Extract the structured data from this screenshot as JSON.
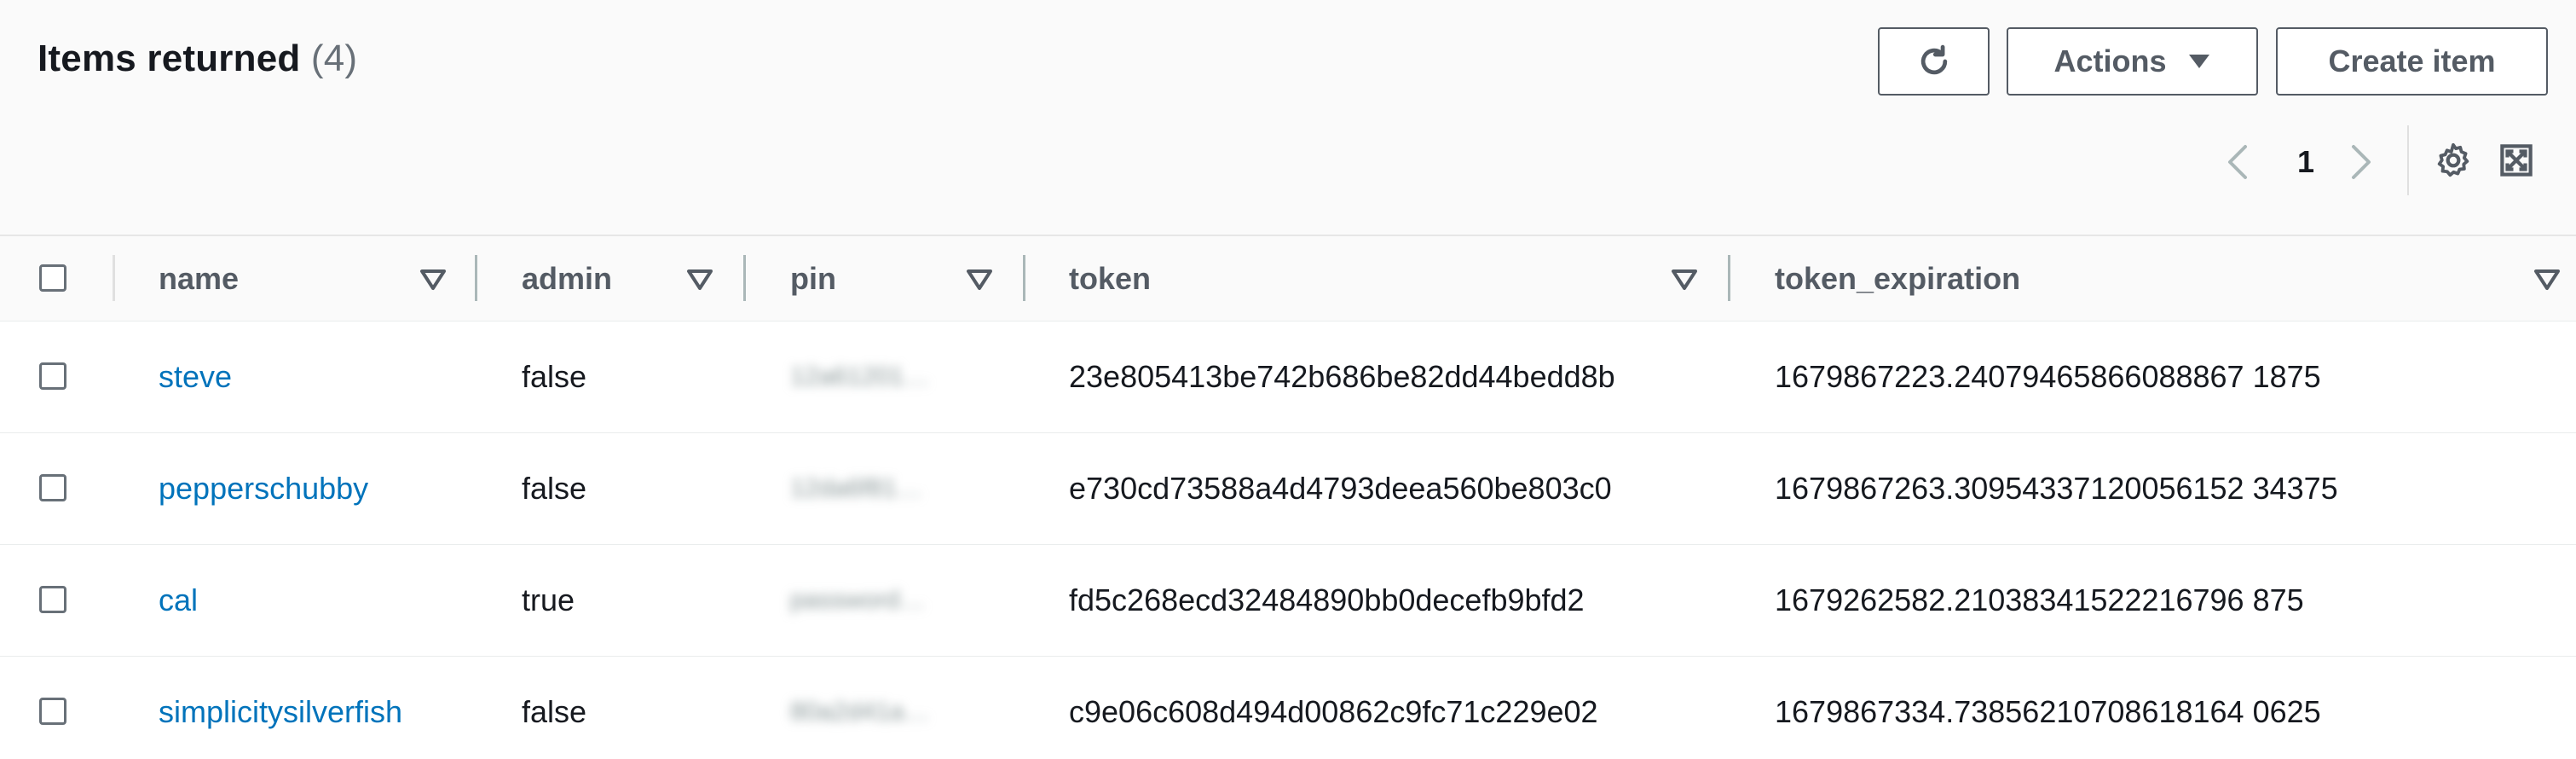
{
  "header": {
    "title": "Items returned",
    "count": "(4)",
    "actions_label": "Actions",
    "create_label": "Create item"
  },
  "pagination": {
    "current_page": "1"
  },
  "table": {
    "columns": [
      "name",
      "admin",
      "pin",
      "token",
      "token_expiration"
    ],
    "rows": [
      {
        "name": "steve",
        "admin": "false",
        "pin": "12a61201…",
        "token": "23e805413be742b686be82dd44bedd8b",
        "token_expiration": "1679867223.24079465866088867 1875"
      },
      {
        "name": "pepperschubby",
        "admin": "false",
        "pin": "12da6f81…",
        "token": "e730cd73588a4d4793deea560be803c0",
        "token_expiration": "1679867263.30954337120056152 34375"
      },
      {
        "name": "cal",
        "admin": "true",
        "pin": "password…",
        "token": "fd5c268ecd32484890bb0decefb9bfd2",
        "token_expiration": "1679262582.21038341522216796 875"
      },
      {
        "name": "simplicitysilverfish",
        "admin": "false",
        "pin": "80a2d41a…",
        "token": "c9e06c608d494d00862c9fc71c229e02",
        "token_expiration": "1679867334.73856210708618164 0625"
      }
    ]
  },
  "colors": {
    "link": "#0073bb",
    "border": "#545b64",
    "header_bg": "#fafafa"
  }
}
